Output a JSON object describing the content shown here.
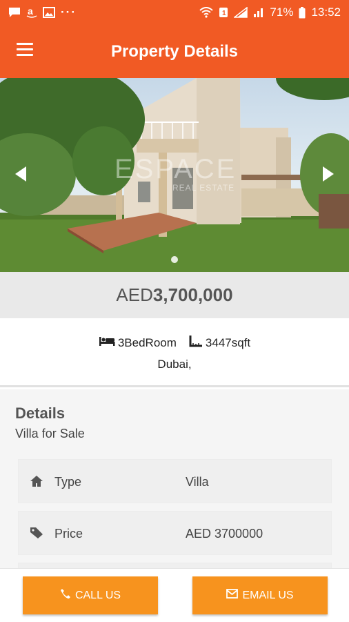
{
  "status_bar": {
    "battery": "71%",
    "time": "13:52",
    "more": "···"
  },
  "header": {
    "title": "Property Details"
  },
  "gallery": {
    "watermark": "ESPACE",
    "watermark_sub": "REAL ESTATE"
  },
  "price": {
    "currency": "AED",
    "amount": "3,700,000"
  },
  "summary": {
    "bedrooms": "3BedRoom",
    "area": "3447sqft",
    "location": "Dubai,"
  },
  "details": {
    "heading": "Details",
    "subheading": "Villa for Sale",
    "rows": [
      {
        "label": "Type",
        "value": "Villa",
        "icon": "home-icon"
      },
      {
        "label": "Price",
        "value": "AED 3700000",
        "icon": "tag-icon"
      }
    ]
  },
  "actions": {
    "call_label": "CALL US",
    "email_label": "EMAIL US"
  },
  "colors": {
    "primary": "#f15a24",
    "button": "#f7931e"
  }
}
